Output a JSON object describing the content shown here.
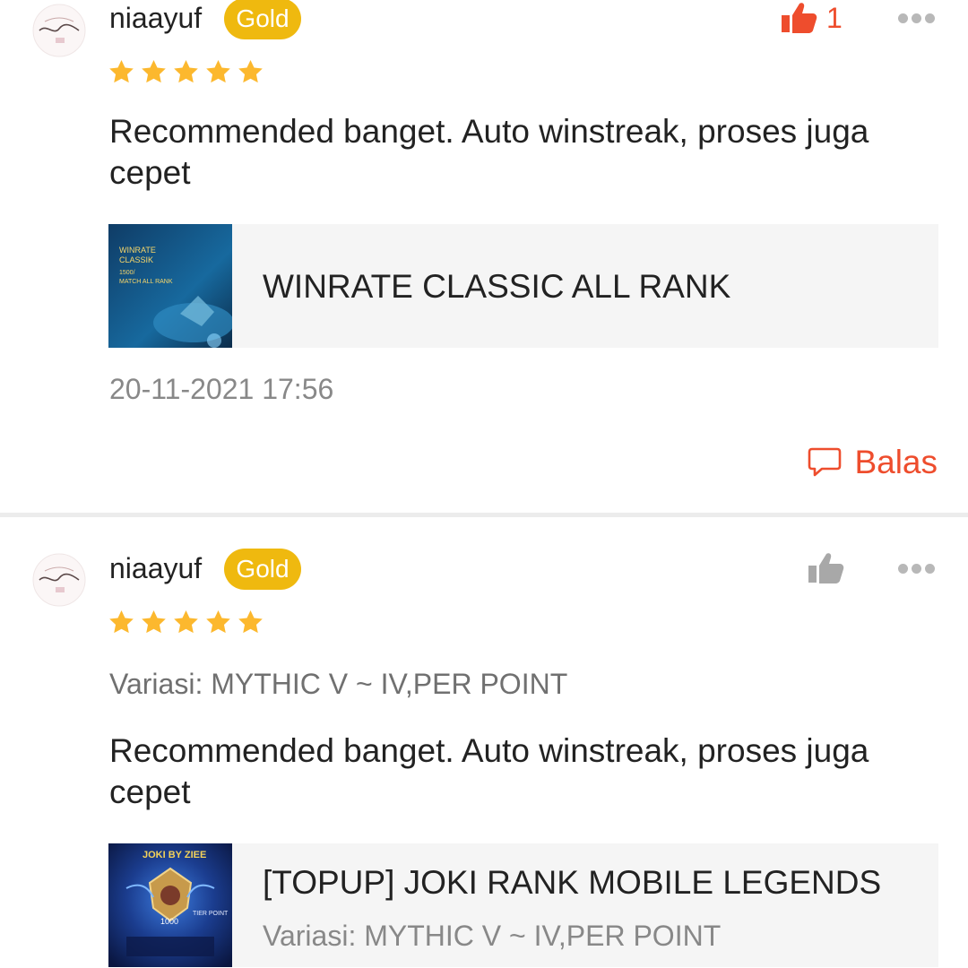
{
  "colors": {
    "accent": "#ee4d2d",
    "gold_badge": "#efb90f",
    "star": "#fcb82e",
    "muted_text": "#888888",
    "inactive_icon": "#a8a8a8"
  },
  "reviews": [
    {
      "username": "niaayuf",
      "badge": "Gold",
      "rating": 5,
      "like_count": "1",
      "liked": true,
      "comment": "Recommended  banget. Auto winstreak, proses juga cepet",
      "product": {
        "title": "WINRATE CLASSIC ALL RANK",
        "thumb_text": [
          "WINRATE",
          "CLASSIK",
          "1500/",
          "MATCH ALL RANK"
        ]
      },
      "timestamp": "20-11-2021 17:56",
      "reply_label": "Balas"
    },
    {
      "username": "niaayuf",
      "badge": "Gold",
      "rating": 5,
      "liked": false,
      "variation": "Variasi: MYTHIC V ~ IV,PER POINT",
      "comment": "Recommended  banget. Auto winstreak, proses juga cepet",
      "product": {
        "title": "[TOPUP] JOKI RANK MOBILE LEGENDS",
        "variant": "Variasi: MYTHIC V ~ IV,PER POINT",
        "thumb_text": [
          "JOKI BY ZIEE",
          "TIER POINT",
          "1000"
        ]
      }
    }
  ]
}
